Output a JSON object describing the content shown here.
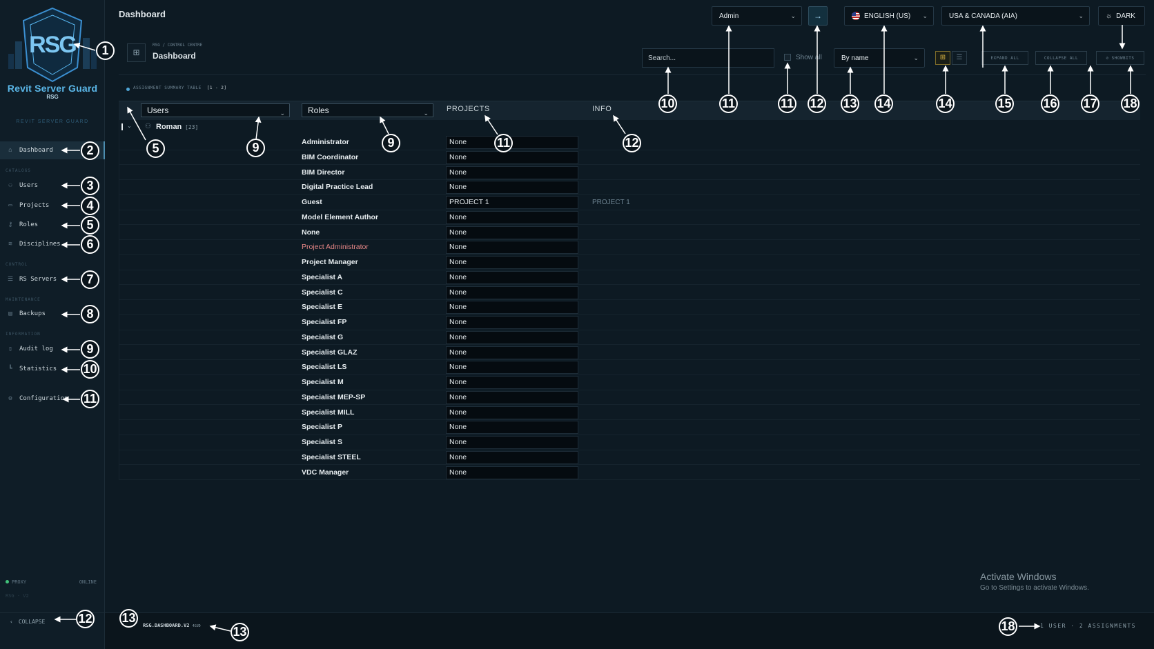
{
  "app": {
    "brand": "Revit Server Guard",
    "brand_abbr": "RSG",
    "caption": "REVIT SERVER GUARD"
  },
  "sidebar": {
    "items": [
      {
        "label": "Dashboard",
        "icon": "home-icon"
      },
      {
        "label": "Users",
        "icon": "users-icon"
      },
      {
        "label": "Projects",
        "icon": "folder-icon"
      },
      {
        "label": "Roles",
        "icon": "key-icon"
      },
      {
        "label": "Disciplines",
        "icon": "layers-icon"
      },
      {
        "label": "RS Servers",
        "icon": "server-icon"
      },
      {
        "label": "Backups",
        "icon": "archive-icon"
      },
      {
        "label": "Audit log",
        "icon": "file-icon"
      },
      {
        "label": "Statistics",
        "icon": "chart-icon"
      },
      {
        "label": "Configuration",
        "icon": "gear-icon"
      }
    ],
    "sections": {
      "catalogs": "CATALOGS",
      "control": "CONTROL",
      "maintenance": "MAINTENANCE",
      "information": "INFORMATION"
    },
    "proxy_label": "PROXY",
    "proxy_status": "ONLINE",
    "version": "RSG · V2",
    "collapse_label": "COLLAPSE"
  },
  "topbar": {
    "title": "Dashboard",
    "user_select": "Admin",
    "language": "ENGLISH (US)",
    "region": "USA & CANADA (AIA)",
    "theme": "DARK"
  },
  "header": {
    "breadcrumb": "RSG / CONTROL CENTRE",
    "title": "Dashboard",
    "search_placeholder": "Search...",
    "show_all": "Show all",
    "sort": "By name",
    "expand_all": "EXPAND ALL",
    "collapse_all": "COLLAPSE ALL",
    "showbits": "SHOWBITS"
  },
  "table": {
    "title": "ASSIGNMENT SUMMARY TABLE",
    "count": "[1 - 2]",
    "col_users": "Users",
    "col_roles": "Roles",
    "col_projects": "PROJECTS",
    "col_info": "INFO",
    "user": {
      "name": "Roman",
      "badge": "[23]"
    },
    "rows": [
      {
        "role": "Administrator",
        "project": "None",
        "info": ""
      },
      {
        "role": "BIM Coordinator",
        "project": "None",
        "info": ""
      },
      {
        "role": "BIM Director",
        "project": "None",
        "info": ""
      },
      {
        "role": "Digital Practice Lead",
        "project": "None",
        "info": ""
      },
      {
        "role": "Guest",
        "project": "PROJECT 1",
        "info": "PROJECT 1"
      },
      {
        "role": "Model Element Author",
        "project": "None",
        "info": ""
      },
      {
        "role": "None",
        "project": "None",
        "info": ""
      },
      {
        "role": "Project Administrator",
        "project": "None",
        "info": ""
      },
      {
        "role": "Project Manager",
        "project": "None",
        "info": ""
      },
      {
        "role": "Specialist A",
        "project": "None",
        "info": ""
      },
      {
        "role": "Specialist C",
        "project": "None",
        "info": ""
      },
      {
        "role": "Specialist E",
        "project": "None",
        "info": ""
      },
      {
        "role": "Specialist FP",
        "project": "None",
        "info": ""
      },
      {
        "role": "Specialist G",
        "project": "None",
        "info": ""
      },
      {
        "role": "Specialist GLAZ",
        "project": "None",
        "info": ""
      },
      {
        "role": "Specialist LS",
        "project": "None",
        "info": ""
      },
      {
        "role": "Specialist M",
        "project": "None",
        "info": ""
      },
      {
        "role": "Specialist MEP-SP",
        "project": "None",
        "info": ""
      },
      {
        "role": "Specialist MILL",
        "project": "None",
        "info": ""
      },
      {
        "role": "Specialist P",
        "project": "None",
        "info": ""
      },
      {
        "role": "Specialist S",
        "project": "None",
        "info": ""
      },
      {
        "role": "Specialist STEEL",
        "project": "None",
        "info": ""
      },
      {
        "role": "VDC Manager",
        "project": "None",
        "info": ""
      }
    ]
  },
  "footer": {
    "version": "RSG.DASHBOARD.V2",
    "version_suffix": "4GUD",
    "summary": "1 USER · 2 ASSIGNMENTS"
  },
  "watermark": {
    "line1": "Activate Windows",
    "line2": "Go to Settings to activate Windows."
  },
  "callouts": {
    "logo": "1",
    "dashboard": "2",
    "users": "3",
    "projects": "4",
    "roles": "5",
    "disciplines": "6",
    "rs_servers": "7",
    "backups": "8",
    "audit": "9",
    "statistics": "10",
    "configuration": "11",
    "collapse": "12",
    "footer_left": "13",
    "footer_ver": "13",
    "tbl_toggle": "5",
    "users_col": "9",
    "roles_col": "9",
    "projects_col": "11",
    "info_col": "12",
    "search": "10",
    "admin": "11",
    "show_all": "11",
    "go": "12",
    "sort": "13",
    "language": "14",
    "view": "14",
    "expand": "15",
    "collapse_all": "16",
    "region": "17",
    "theme": "18",
    "summary": "18"
  },
  "colors": {
    "background": "#0d1a23",
    "accent": "#4fa6d8",
    "highlight_role": "#e58686",
    "online": "#41c37a"
  }
}
